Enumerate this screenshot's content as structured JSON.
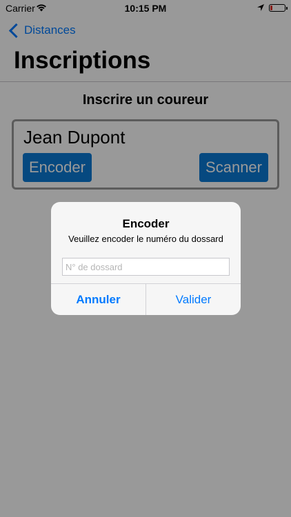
{
  "status_bar": {
    "carrier": "Carrier",
    "time": "10:15 PM"
  },
  "nav": {
    "back_label": "Distances",
    "title": "Inscriptions"
  },
  "section": {
    "title": "Inscrire un coureur"
  },
  "runner": {
    "name": "Jean Dupont",
    "encoder_label": "Encoder",
    "scanner_label": "Scanner"
  },
  "alert": {
    "title": "Encoder",
    "message": "Veuillez encoder le numéro du dossard",
    "input_placeholder": "N° de dossard",
    "input_value": "",
    "cancel_label": "Annuler",
    "confirm_label": "Valider"
  },
  "colors": {
    "accent": "#007aff",
    "button_bg": "#0a7bd6",
    "battery_low": "#e0332a"
  },
  "icons": {
    "wifi": "wifi-icon",
    "location": "location-arrow-icon",
    "battery": "battery-icon",
    "back": "chevron-left-icon"
  }
}
